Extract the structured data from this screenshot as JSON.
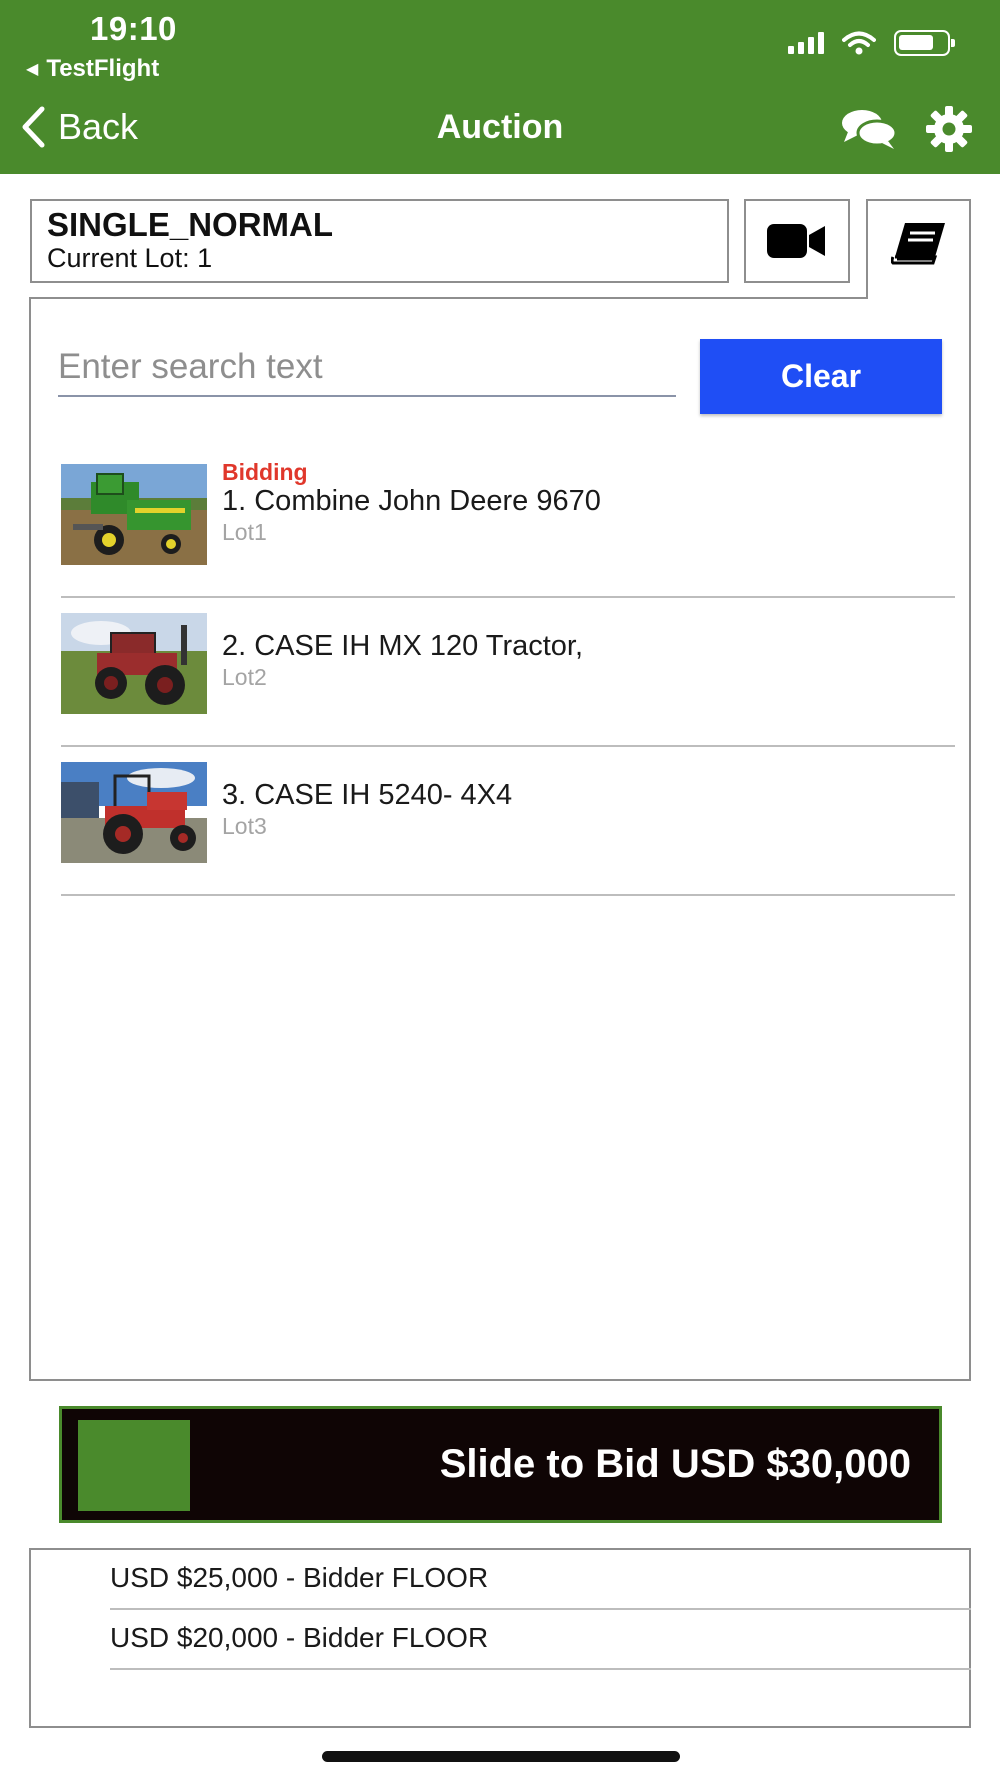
{
  "status_bar": {
    "time": "19:10",
    "return_app": "TestFlight"
  },
  "nav": {
    "back_label": "Back",
    "title": "Auction",
    "icons": [
      "chat-icon",
      "gear-icon"
    ]
  },
  "sale": {
    "name": "SINGLE_NORMAL",
    "current_lot": "Current Lot: 1",
    "tabs": [
      "video-camera-icon",
      "catalog-book-icon"
    ]
  },
  "search": {
    "placeholder": "Enter search text",
    "value": "",
    "clear_label": "Clear"
  },
  "lots": [
    {
      "status": "Bidding",
      "name": "1. Combine John Deere 9670",
      "code": "Lot1",
      "image": "green combine harvester"
    },
    {
      "status": "",
      "name": "2. CASE IH MX 120 Tractor,",
      "code": "Lot2",
      "image": "red tractor"
    },
    {
      "status": "",
      "name": "3. CASE IH 5240- 4X4",
      "code": "Lot3",
      "image": "red tractor"
    }
  ],
  "bid": {
    "slider_label": "Slide to Bid USD $30,000"
  },
  "bid_history": [
    "USD $25,000 - Bidder FLOOR",
    "USD $20,000 - Bidder FLOOR"
  ],
  "colors": {
    "brand_green": "#4a8a2c",
    "clear_blue": "#1f4ef5",
    "bidding_red": "#e0372b",
    "slider_bg": "#0f0505"
  }
}
